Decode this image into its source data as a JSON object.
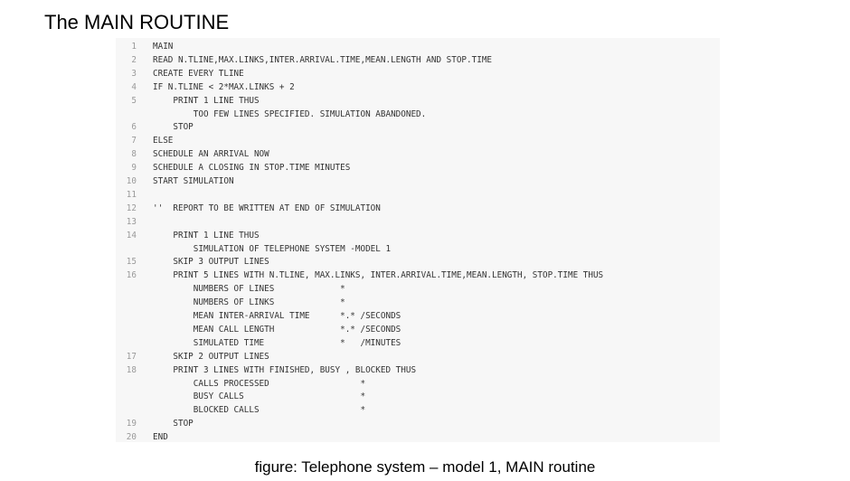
{
  "title": "The MAIN ROUTINE",
  "code_lines": [
    {
      "ln": "1",
      "text": "MAIN"
    },
    {
      "ln": "2",
      "text": "READ N.TLINE,MAX.LINKS,INTER.ARRIVAL.TIME,MEAN.LENGTH AND STOP.TIME"
    },
    {
      "ln": "3",
      "text": "CREATE EVERY TLINE"
    },
    {
      "ln": "4",
      "text": "IF N.TLINE < 2*MAX.LINKS + 2"
    },
    {
      "ln": "5",
      "text": "    PRINT 1 LINE THUS"
    },
    {
      "ln": "",
      "text": "        TOO FEW LINES SPECIFIED. SIMULATION ABANDONED."
    },
    {
      "ln": "6",
      "text": "    STOP"
    },
    {
      "ln": "7",
      "text": "ELSE"
    },
    {
      "ln": "8",
      "text": "SCHEDULE AN ARRIVAL NOW"
    },
    {
      "ln": "9",
      "text": "SCHEDULE A CLOSING IN STOP.TIME MINUTES"
    },
    {
      "ln": "10",
      "text": "START SIMULATION"
    },
    {
      "ln": "11",
      "text": ""
    },
    {
      "ln": "12",
      "text": "''  REPORT TO BE WRITTEN AT END OF SIMULATION"
    },
    {
      "ln": "13",
      "text": ""
    },
    {
      "ln": "14",
      "text": "    PRINT 1 LINE THUS"
    },
    {
      "ln": "",
      "text": "        SIMULATION OF TELEPHONE SYSTEM -MODEL 1"
    },
    {
      "ln": "15",
      "text": "    SKIP 3 OUTPUT LINES"
    },
    {
      "ln": "16",
      "text": "    PRINT 5 LINES WITH N.TLINE, MAX.LINKS, INTER.ARRIVAL.TIME,MEAN.LENGTH, STOP.TIME THUS"
    },
    {
      "ln": "",
      "text": "        NUMBERS OF LINES             *"
    },
    {
      "ln": "",
      "text": "        NUMBERS OF LINKS             *"
    },
    {
      "ln": "",
      "text": "        MEAN INTER-ARRIVAL TIME      *.* /SECONDS"
    },
    {
      "ln": "",
      "text": "        MEAN CALL LENGTH             *.* /SECONDS"
    },
    {
      "ln": "",
      "text": "        SIMULATED TIME               *   /MINUTES"
    },
    {
      "ln": "17",
      "text": "    SKIP 2 OUTPUT LINES"
    },
    {
      "ln": "18",
      "text": "    PRINT 3 LINES WITH FINISHED, BUSY , BLOCKED THUS"
    },
    {
      "ln": "",
      "text": "        CALLS PROCESSED                  *"
    },
    {
      "ln": "",
      "text": "        BUSY CALLS                       *"
    },
    {
      "ln": "",
      "text": "        BLOCKED CALLS                    *"
    },
    {
      "ln": "19",
      "text": "    STOP"
    },
    {
      "ln": "20",
      "text": "END"
    }
  ],
  "caption": "figure: Telephone system – model 1, MAIN routine"
}
